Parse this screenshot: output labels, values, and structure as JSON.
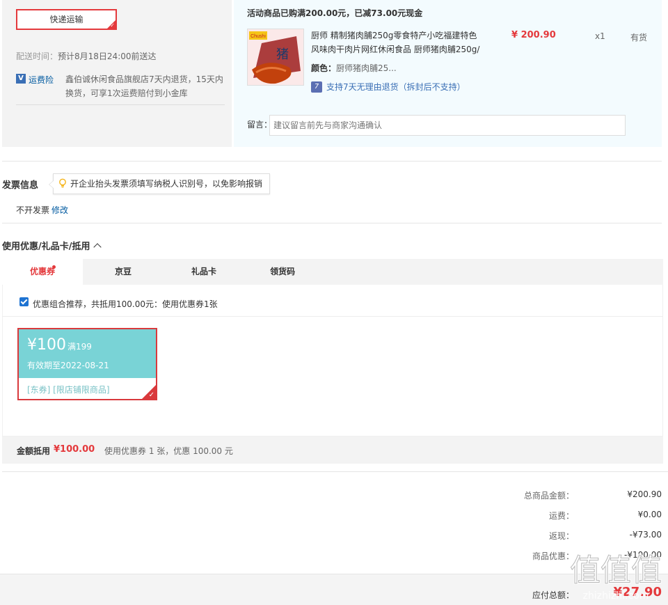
{
  "shipping": {
    "method_label": "快递运输",
    "delivery_label": "配送时间：",
    "delivery_value": "预计8月18日24:00前送达",
    "insurance_icon": "shield-v-icon",
    "insurance_label": "运费险",
    "insurance_text": "鑫伯诚休闲食品旗舰店7天内退货，15天内换货，可享1次运费赔付到小金库"
  },
  "promo": {
    "title": "活动商品已购满200.00元，已减73.00元现金"
  },
  "product": {
    "name": "厨师 精制猪肉脯250g零食特产小吃福建特色风味肉干肉片网红休闲食品 厨师猪肉脯250g/",
    "price": "¥ 200.90",
    "qty": "x1",
    "stock": "有货",
    "color_label": "颜色：",
    "color_value": "厨师猪肉脯25...",
    "return_icon": "seven-day-return-icon",
    "return_text": "支持7天无理由退货（拆封后不支持）",
    "img_logo": "Chushi",
    "img_char": "猪"
  },
  "message": {
    "label": "留言：",
    "placeholder": "建议留言前先与商家沟通确认"
  },
  "invoice": {
    "title": "发票信息",
    "tip": "开企业抬头发票须填写纳税人识别号，以免影响报销",
    "value": "不开发票",
    "edit": "修改"
  },
  "coupons": {
    "title": "使用优惠/礼品卡/抵用",
    "tabs": [
      {
        "label": "优惠券"
      },
      {
        "label": "京豆"
      },
      {
        "label": "礼品卡"
      },
      {
        "label": "领货码"
      }
    ],
    "combo_text": "优惠组合推荐，共抵用100.00元：使用优惠券1张",
    "card": {
      "amount": "¥100",
      "condition": "满199",
      "expire": "有效期至2022-08-21",
      "tags": "[东券]  [限店铺限商品]"
    },
    "discount_label": "金额抵用",
    "discount_amount": "¥100.00",
    "discount_info": "使用优惠券 1 张，优惠 100.00 元"
  },
  "summary": {
    "rows": [
      {
        "label": "总商品金额：",
        "value": "¥200.90"
      },
      {
        "label": "运费：",
        "value": "¥0.00"
      },
      {
        "label": "返现：",
        "value": "-¥73.00"
      },
      {
        "label": "商品优惠：",
        "value": "-¥100.00"
      }
    ],
    "pay_label": "应付总额：",
    "pay_value": "¥27.90"
  },
  "watermark": {
    "big": "值值值",
    "small": "zhizhizhi.com"
  },
  "colors": {
    "accent": "#e4393c",
    "link": "#005aa0",
    "coupon": "#79d3d6"
  }
}
